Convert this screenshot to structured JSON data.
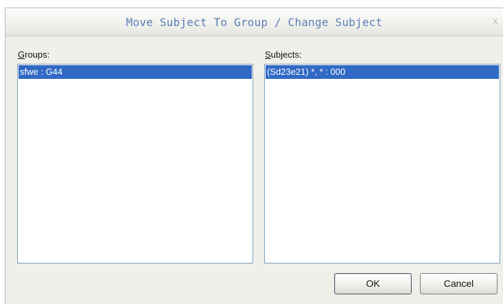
{
  "dialog": {
    "title": "Move Subject To Group / Change Subject",
    "close_glyph": "x"
  },
  "groups": {
    "label_mnemonic": "G",
    "label_rest": "roups:",
    "items": [
      "sfwe : G44"
    ],
    "selected_index": 0
  },
  "subjects": {
    "label_mnemonic": "S",
    "label_rest": "ubjects:",
    "items": [
      "(Sd23e21) *, * : 000"
    ],
    "selected_index": 0
  },
  "buttons": {
    "ok_label": "OK",
    "cancel_label": "Cancel"
  },
  "colors": {
    "title_text": "#5a7fb4",
    "selection": "#316ac5",
    "dialog_bg": "#f0efea"
  }
}
